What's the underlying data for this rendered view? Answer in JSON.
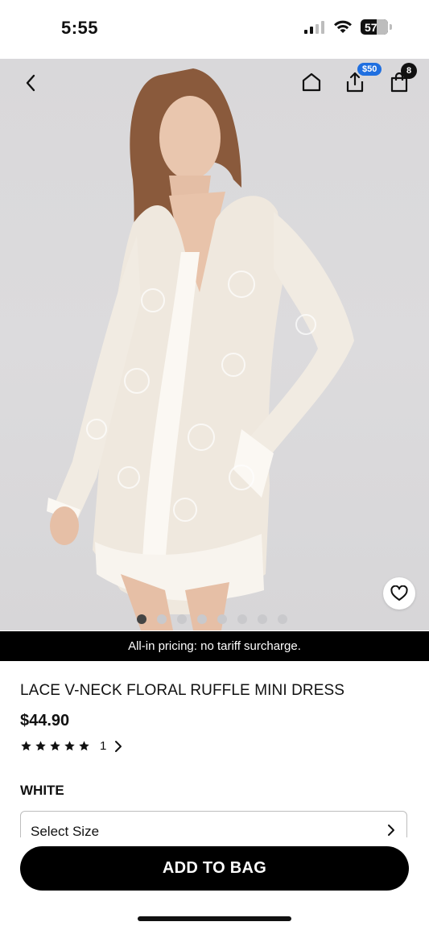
{
  "status_bar": {
    "time": "5:55",
    "battery": "57"
  },
  "header": {
    "share_badge": "$50",
    "bag_count": "8"
  },
  "hero": {
    "image_count": 8,
    "active_index": 0
  },
  "banner": {
    "text": "All-in pricing: no tariff surcharge."
  },
  "product": {
    "title": "LACE V-NECK FLORAL RUFFLE MINI DRESS",
    "price": "$44.90",
    "rating_stars": 5,
    "review_count": "1",
    "color": "WHITE"
  },
  "size_select": {
    "placeholder": "Select Size"
  },
  "actions": {
    "add_to_bag": "ADD TO BAG"
  },
  "icons": [
    "back-icon",
    "home-icon",
    "share-icon",
    "bag-icon",
    "heart-icon",
    "chevron-right-icon",
    "star-icon",
    "signal-icon",
    "wifi-icon",
    "battery-icon"
  ]
}
